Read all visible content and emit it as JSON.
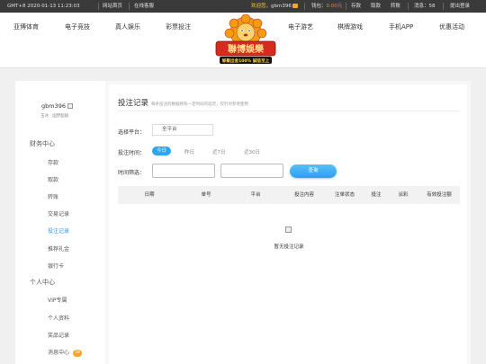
{
  "topbar": {
    "time": "GMT+8   2020-01-13   11:23:03",
    "home_link": "网站首页",
    "service_link": "在线客服",
    "welcome_prefix": "欢迎您，",
    "username": "gbm396",
    "wallet_label": "钱包：",
    "wallet_value": "0.00元",
    "deposit": "存款",
    "withdraw": "取款",
    "transfer": "转账",
    "messages": "消息：58",
    "logout": "提出登录"
  },
  "nav": {
    "items": [
      "亚博体育",
      "电子竞技",
      "真人娱乐",
      "彩票投注",
      "电子游艺",
      "棋牌游戏",
      "手机APP",
      "优惠活动"
    ],
    "logo_text": "聯博娛樂",
    "logo_slogan": "够聚出金100% 誠信至上"
  },
  "sidebar": {
    "username": "gbm396",
    "level": "玉冰 · 国梦超级",
    "finance_head": "财务中心",
    "finance_items": [
      "存款",
      "取款",
      "转账",
      "交易记录",
      "投注记录",
      "推荐礼金",
      "银行卡"
    ],
    "personal_head": "个人中心",
    "personal_items": [
      "VIP专属",
      "个人资料",
      "奖品记录",
      "消息中心"
    ],
    "message_badge": "58"
  },
  "main": {
    "title": "投注记录",
    "subtitle": "每条投注的数据将有一定时间的延迟，仅针对参考使用",
    "platform_label": "选择平台：",
    "platform_value": "全平台",
    "time_label": "投注时间：",
    "periods": [
      "今日",
      "昨日",
      "近7日",
      "近30日"
    ],
    "filter_label": "时间筛选：",
    "date_sep": "-",
    "query_button": "查询",
    "columns": [
      "日期",
      "单号",
      "平台",
      "投注内容",
      "注单状态",
      "投注",
      "派彩",
      "有效投注额"
    ],
    "empty_text": "暂无投注记录"
  },
  "colors": {
    "accent": "#2ea5f0",
    "topbar_bg": "#3a3a3a",
    "badge": "#f5a623"
  }
}
